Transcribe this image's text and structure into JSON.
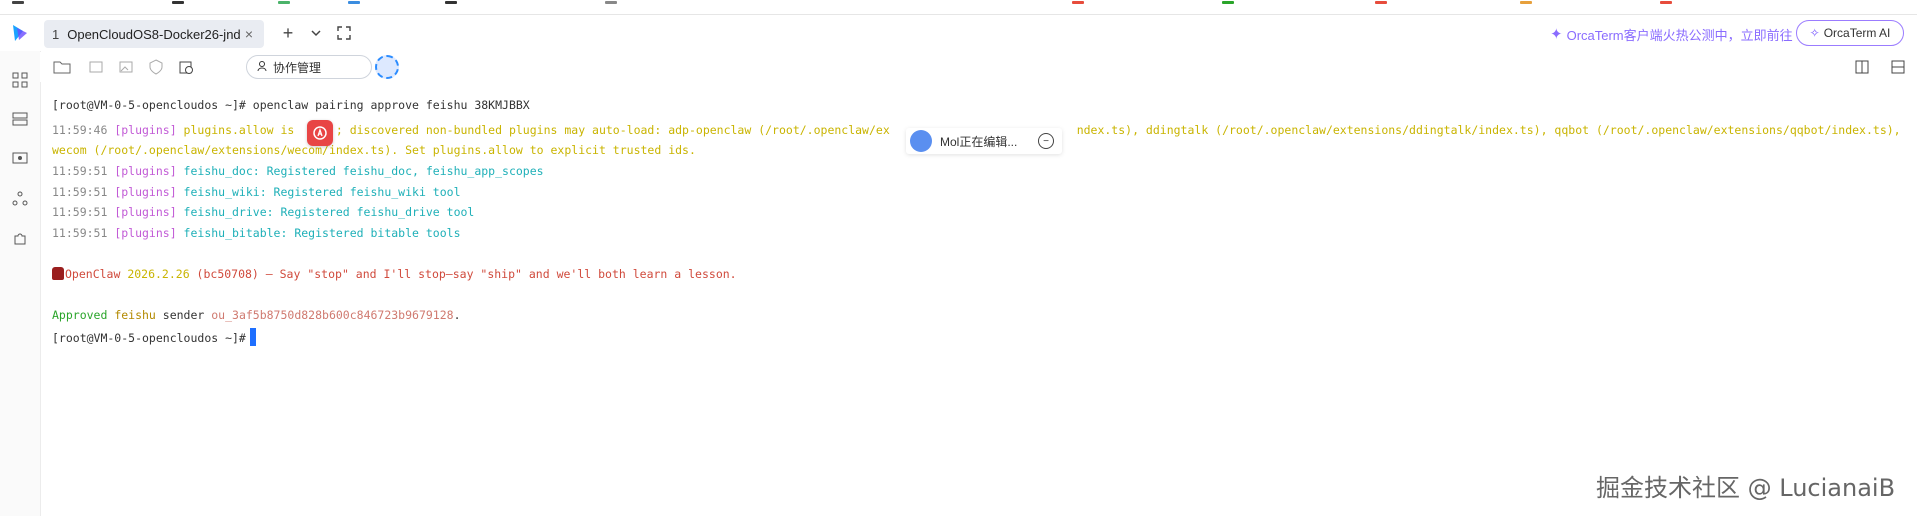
{
  "tab": {
    "number": "1",
    "title": "OpenCloudOS8-Docker26-jndo",
    "close": "×"
  },
  "tabbar": {
    "add": "+",
    "dropdown": "⌄",
    "expand": "⛶"
  },
  "promo": {
    "text": "OrcaTerm客户端火热公测中，立即前往"
  },
  "ai_button": {
    "label": "OrcaTerm AI"
  },
  "toolbar": {
    "collab_label": "协作管理"
  },
  "terminal": {
    "line1_prompt": "[root@VM-0-5-opencloudos ~]# openclaw pairing approve feishu 38KMJBBX",
    "line2_time": "11:59:46 ",
    "line2_tag": "[plugins]",
    "line2_text": " plugins.allow is      ; discovered non-bundled plugins may auto-load: adp-openclaw (/root/.openclaw/ex                           ndex.ts), ddingtalk (/root/.openclaw/extensions/ddingtalk/index.ts), qqbot (/root/.openclaw/extensions/qqbot/index.ts),",
    "line3_text": "wecom (/root/.openclaw/extensions/wecom/index.ts). Set plugins.allow to explicit trusted ids.",
    "line4_time": "11:59:51 ",
    "line4_tag": "[plugins]",
    "line4_text": " feishu_doc: Registered feishu_doc, feishu_app_scopes",
    "line5_time": "11:59:51 ",
    "line5_tag": "[plugins]",
    "line5_text": " feishu_wiki: Registered feishu_wiki tool",
    "line6_time": "11:59:51 ",
    "line6_tag": "[plugins]",
    "line6_text": " feishu_drive: Registered feishu_drive tool",
    "line7_time": "11:59:51 ",
    "line7_tag": "[plugins]",
    "line7_text": " feishu_bitable: Registered bitable tools",
    "banner_name": "OpenClaw ",
    "banner_version": "2026.2.26",
    "banner_rest": " (bc50708) — Say \"stop\" and I'll stop—say \"ship\" and we'll both learn a lesson.",
    "approved_word": "Approved ",
    "approved_channel": "feishu",
    "approved_sender": " sender ",
    "approved_id": "ou_3af5b8750d828b600c846723b9679128",
    "approved_dot": ".",
    "final_prompt": "[root@VM-0-5-opencloudos ~]#"
  },
  "editing_popup": {
    "text": "Mol正在编辑..."
  },
  "watermark": {
    "text": "掘金技术社区 @ LucianaiB"
  },
  "colors": {
    "accent": "#1e6fff",
    "ai": "#9b7cff",
    "badge_red": "#e84545"
  }
}
